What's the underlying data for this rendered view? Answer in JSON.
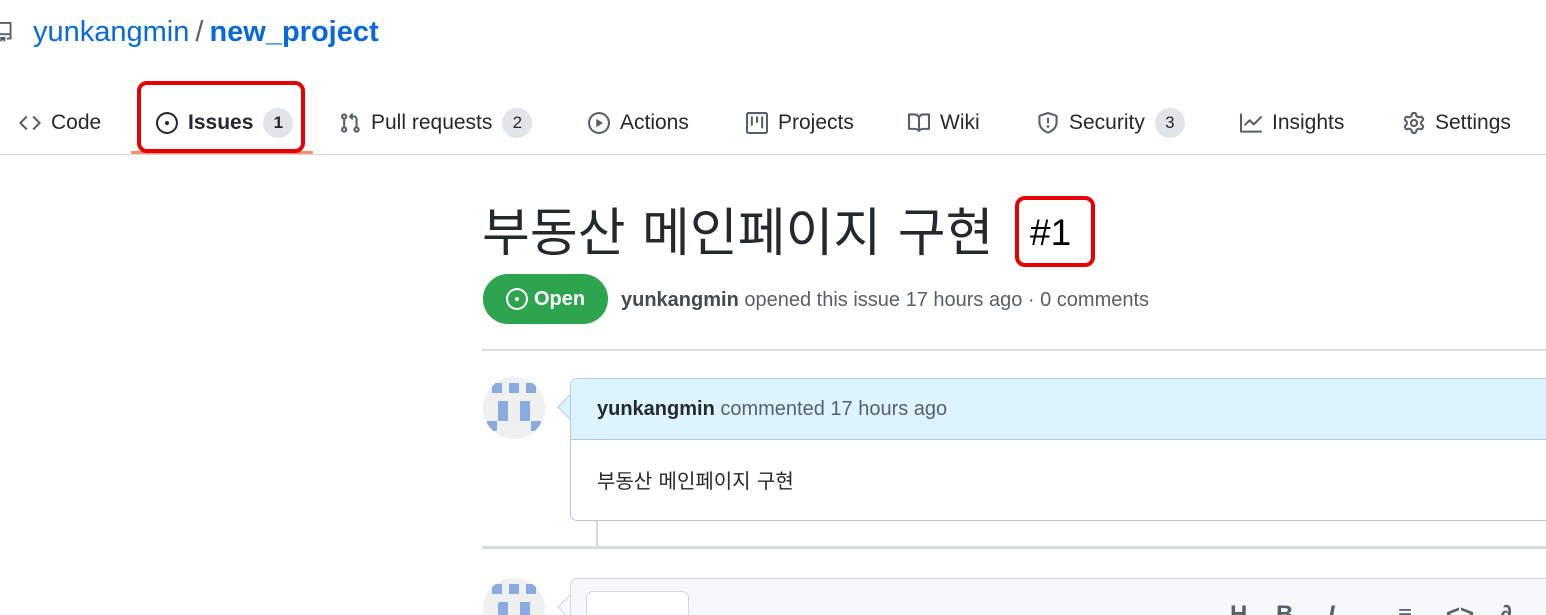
{
  "repo": {
    "owner": "yunkangmin",
    "separator": "/",
    "name": "new_project"
  },
  "tabs": [
    {
      "label": "Code",
      "icon": "code-icon"
    },
    {
      "label": "Issues",
      "icon": "issue-opened-icon",
      "count": "1",
      "selected": true
    },
    {
      "label": "Pull requests",
      "icon": "git-pull-request-icon",
      "count": "2"
    },
    {
      "label": "Actions",
      "icon": "play-icon"
    },
    {
      "label": "Projects",
      "icon": "project-icon"
    },
    {
      "label": "Wiki",
      "icon": "book-icon"
    },
    {
      "label": "Security",
      "icon": "shield-icon",
      "count": "3"
    },
    {
      "label": "Insights",
      "icon": "graph-icon"
    },
    {
      "label": "Settings",
      "icon": "gear-icon"
    }
  ],
  "issue": {
    "title": "부동산 메인페이지 구현",
    "number": "#1",
    "state": "Open",
    "author": "yunkangmin",
    "meta_text": "opened this issue 17 hours ago · 0 comments"
  },
  "comment": {
    "author": "yunkangmin",
    "meta_text": "commented 17 hours ago",
    "body": "부동산 메인페이지 구현"
  },
  "editor_toolbar": [
    "H",
    "B",
    "I",
    "≡",
    "<>",
    "∂"
  ],
  "colors": {
    "open_green": "#2da44e",
    "link_blue": "#0969da",
    "highlight_red": "#e60000",
    "tab_underline": "#fd8c73"
  }
}
